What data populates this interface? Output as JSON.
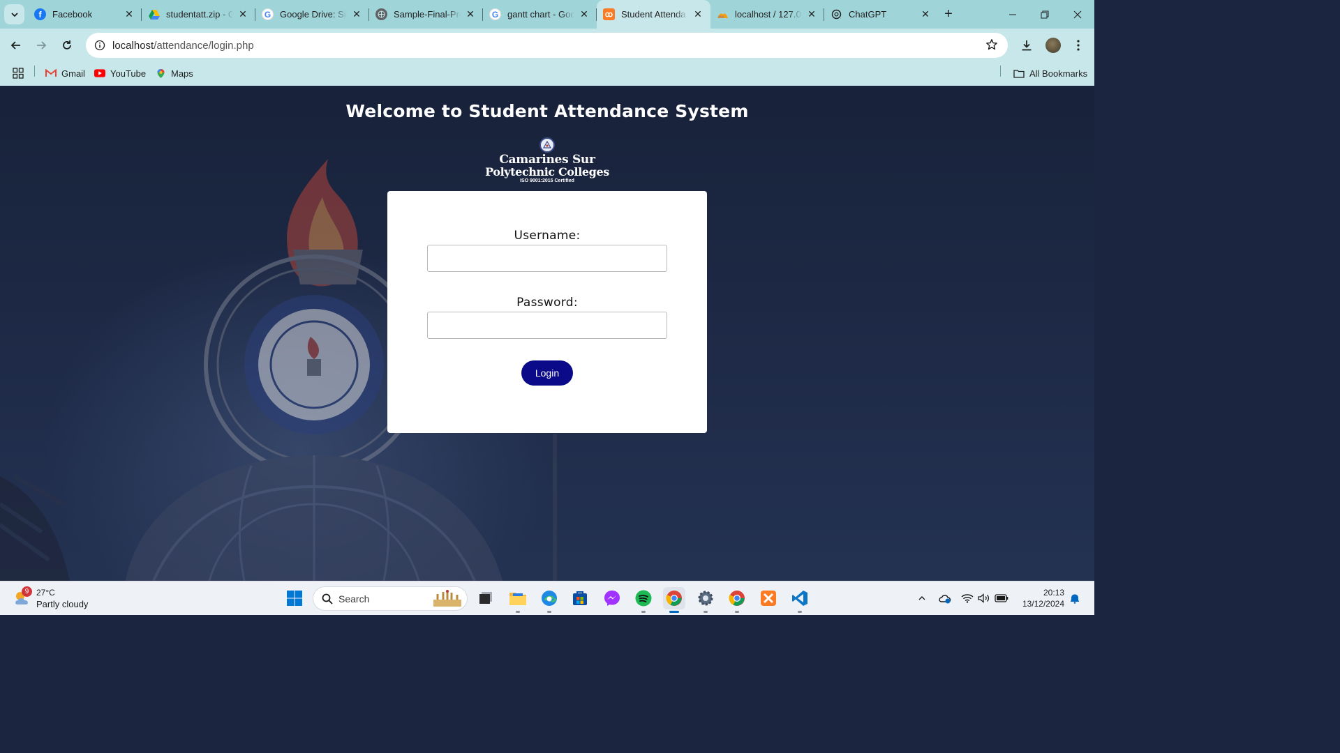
{
  "browser": {
    "tabs": [
      {
        "title": "Facebook",
        "icon": "facebook-icon"
      },
      {
        "title": "studentatt.zip - G",
        "icon": "google-drive-icon"
      },
      {
        "title": "Google Drive: Sig",
        "icon": "google-icon"
      },
      {
        "title": "Sample-Final-Pro",
        "icon": "globe-icon"
      },
      {
        "title": "gantt chart - Goo",
        "icon": "google-icon"
      },
      {
        "title": "Student Attenda",
        "icon": "xampp-icon",
        "active": true
      },
      {
        "title": "localhost / 127.0",
        "icon": "phpmyadmin-icon"
      },
      {
        "title": "ChatGPT",
        "icon": "chatgpt-icon"
      }
    ],
    "url_host": "localhost",
    "url_path": "/attendance/login.php",
    "bookmarks": [
      {
        "label": "Gmail",
        "icon": "gmail-icon"
      },
      {
        "label": "YouTube",
        "icon": "youtube-icon"
      },
      {
        "label": "Maps",
        "icon": "maps-icon"
      }
    ],
    "all_bookmarks_label": "All Bookmarks"
  },
  "page": {
    "welcome": "Welcome to Student Attendance System",
    "logo": {
      "line1": "Camarines Sur",
      "line2": "Polytechnic Colleges",
      "line3": "ISO 9001:2015 Certified"
    },
    "form": {
      "username_label": "Username:",
      "username_value": "",
      "password_label": "Password:",
      "password_value": "",
      "login_button": "Login"
    }
  },
  "taskbar": {
    "weather_badge": "9",
    "temperature": "27°C",
    "condition": "Partly cloudy",
    "search_placeholder": "Search",
    "time": "20:13",
    "date": "13/12/2024"
  },
  "colors": {
    "tab_strip": "#9fd4d9",
    "toolbar": "#c8e7ea",
    "login_button": "#0b0b8a",
    "page_background": "#1e2a47"
  }
}
